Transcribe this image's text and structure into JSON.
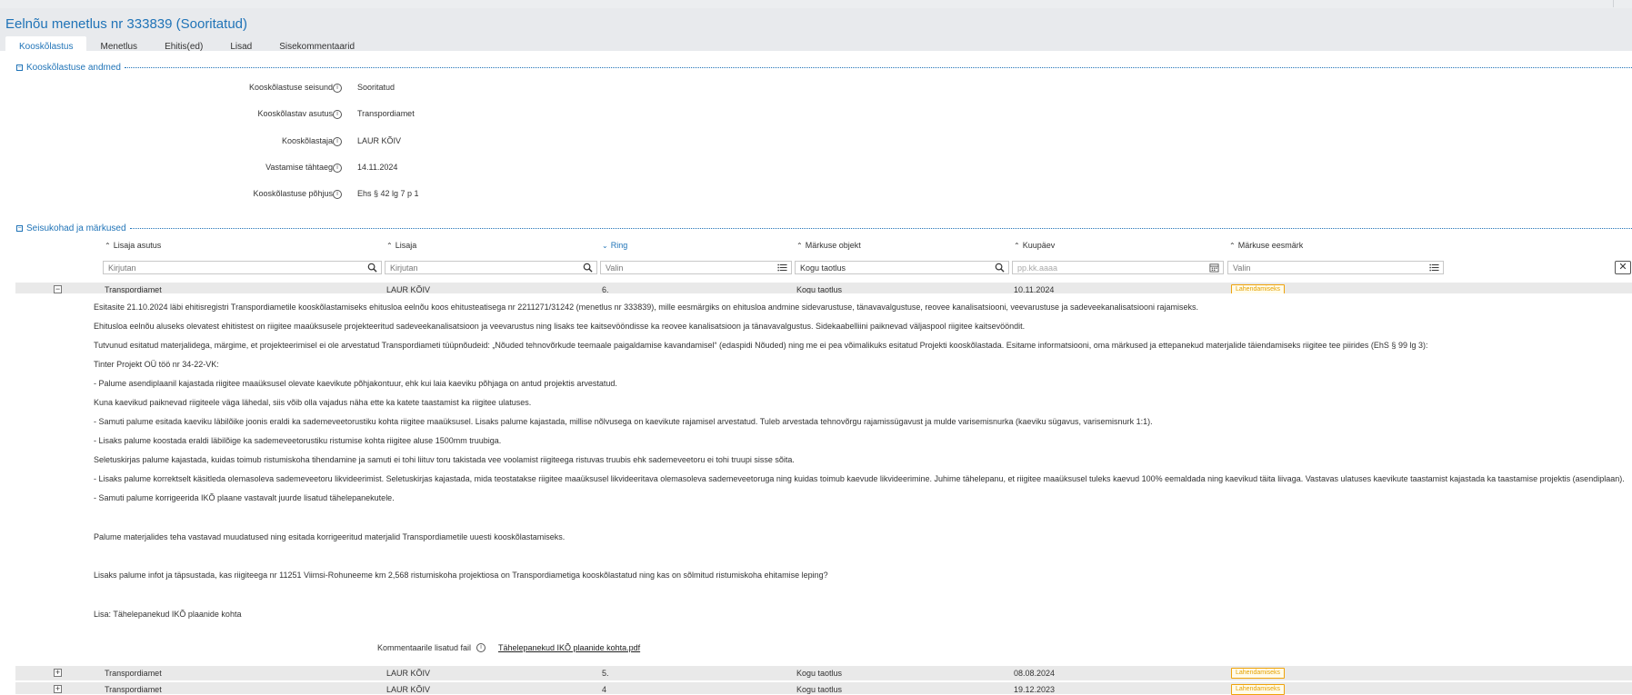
{
  "page": {
    "title": "Eelnõu menetlus nr 333839 (Sooritatud)",
    "tabs": [
      "Kooskõlastus",
      "Menetlus",
      "Ehitis(ed)",
      "Lisad",
      "Sisekommentaarid"
    ]
  },
  "approval": {
    "section_title": "Kooskõlastuse andmed",
    "fields": [
      {
        "label": "Kooskõlastuse seisund",
        "value": "Sooritatud"
      },
      {
        "label": "Kooskõlastav asutus",
        "value": "Transpordiamet"
      },
      {
        "label": "Kooskõlastaja",
        "value": "LAUR KÕIV"
      },
      {
        "label": "Vastamise tähtaeg",
        "value": "14.11.2024"
      },
      {
        "label": "Kooskõlastuse põhjus",
        "value": "Ehs § 42 lg 7 p 1"
      }
    ]
  },
  "remarks": {
    "section_title": "Seisukohad ja märkused",
    "columns": [
      "Lisaja asutus",
      "Lisaja",
      "Ring",
      "Märkuse objekt",
      "Kuupäev",
      "Märkuse eesmärk"
    ],
    "filters": {
      "org_placeholder": "Kirjutan",
      "author_placeholder": "Kirjutan",
      "ring_value": "Valin",
      "object_value": "Kogu taotlus",
      "date_placeholder": "pp.kk.aaaa",
      "purpose_value": "Valin",
      "clear": "✕"
    },
    "rows": [
      {
        "toggle": "−",
        "org": "Transpordiamet",
        "author": "LAUR KÕIV",
        "ring": "6.",
        "object": "Kogu taotlus",
        "date": "10.11.2024",
        "purpose": "Lahendamiseks"
      },
      {
        "toggle": "+",
        "org": "Transpordiamet",
        "author": "LAUR KÕIV",
        "ring": "5.",
        "object": "Kogu taotlus",
        "date": "08.08.2024",
        "purpose": "Lahendamiseks"
      },
      {
        "toggle": "+",
        "org": "Transpordiamet",
        "author": "LAUR KÕIV",
        "ring": "4",
        "object": "Kogu taotlus",
        "date": "19.12.2023",
        "purpose": "Lahendamiseks"
      }
    ],
    "expanded_text": [
      "Esitasite 21.10.2024 läbi ehitisregistri Transpordiametile kooskõlastamiseks ehitusloa eelnõu koos ehitusteatisega nr 2211271/31242 (menetlus nr 333839), mille eesmärgiks on ehitusloa andmine sidevarustuse, tänavavalgustuse, reovee kanalisatsiooni, veevarustuse ja sadeveekanalisatsiooni rajamiseks.",
      "Ehitusloa eelnõu aluseks olevatest ehitistest on riigitee maaüksusele projekteeritud sadeveekanalisatsioon ja veevarustus ning lisaks tee kaitsevööndisse ka reovee kanalisatsioon ja tänavavalgustus. Sidekaabelliini paiknevad väljaspool riigitee kaitsevööndit.",
      "Tutvunud esitatud materjalidega, märgime, et projekteerimisel ei ole arvestatud Transpordiameti tüüpnõudeid: „Nõuded tehnovõrkude teemaale paigaldamise kavandamisel“ (edaspidi Nõuded) ning me ei pea võimalikuks esitatud Projekti kooskõlastada. Esitame informatsiooni, oma märkused ja ettepanekud materjalide täiendamiseks riigitee tee piirides (EhS § 99 lg 3):",
      "Tinter Projekt OÜ töö nr 34-22-VK:",
      "-  Palume asendiplaanil kajastada riigitee maaüksusel olevate kaevikute põhjakontuur, ehk kui laia kaeviku põhjaga on antud projektis arvestatud.",
      "Kuna kaevikud paiknevad riigiteele väga lähedal, siis võib olla vajadus näha ette ka katete taastamist ka riigitee ulatuses.",
      "-  Samuti palume esitada kaeviku läbilõike joonis eraldi ka sademeveetorustiku kohta riigitee maaüksusel. Lisaks palume kajastada, millise nõlvusega on kaevikute rajamisel arvestatud. Tuleb arvestada tehnovõrgu rajamissügavust ja mulde varisemisnurka (kaeviku sügavus, varisemisnurk 1:1).",
      "-  Lisaks palume koostada eraldi läbilõige ka sademeveetorustiku ristumise kohta riigitee aluse 1500mm truubiga.",
      "Seletuskirjas palume kajastada, kuidas toimub ristumiskoha tihendamine ja samuti ei tohi liituv toru takistada vee voolamist riigiteega ristuvas truubis ehk sademeveetoru ei tohi truupi sisse sõita.",
      "-  Lisaks palume korrektselt käsitleda olemasoleva sademeveetoru likvideerimist. Seletuskirjas kajastada, mida teostatakse riigitee maaüksusel likvideeritava olemasoleva sademeveetoruga ning kuidas toimub kaevude likvideerimine. Juhime tähelepanu, et riigitee maaüksusel tuleks kaevud 100% eemaldada ning kaevikud täita liivaga. Vastavas ulatuses kaevikute taastamist kajastada ka taastamise projektis (asendiplaan).",
      "-  Samuti palume korrigeerida IKÕ plaane vastavalt juurde lisatud tähelepanekutele.",
      "Palume materjalides teha vastavad muudatused ning esitada korrigeeritud materjalid Transpordiametile uuesti kooskõlastamiseks.",
      "Lisaks palume infot ja täpsustada, kas riigiteega nr 11251 Viimsi-Rohuneeme km 2,568 ristumiskoha projektiosa on Transpordiametiga kooskõlastatud ning kas on sõlmitud ristumiskoha ehitamise leping?",
      "Lisa: Tähelepanekud IKÕ plaanide kohta"
    ],
    "attachment_label": "Kommentaarile lisatud fail",
    "attachment_file": "Tähelepanekud IKÕ plaanide kohta.pdf"
  },
  "icons": {
    "info": "info-circle-icon",
    "search": "search-icon",
    "list": "list-icon",
    "calendar": "calendar-icon",
    "sort": "sort-icon"
  },
  "colors": {
    "accent": "#1f73b7",
    "badge_border": "#f0a30a",
    "row_bg": "#e9e9e9"
  }
}
